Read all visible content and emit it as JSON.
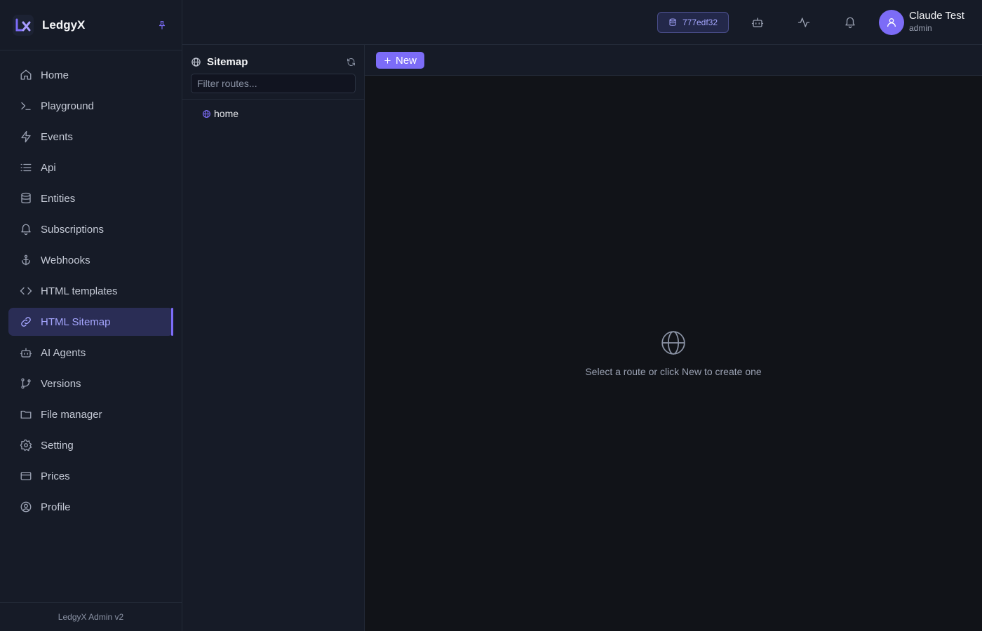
{
  "app": {
    "name": "LedgyX",
    "footer": "LedgyX Admin v2"
  },
  "colors": {
    "accent": "#7c6cf7",
    "active_bg": "#2a2d55",
    "sidebar_bg": "#161b27",
    "main_bg": "#111318"
  },
  "sidebar": {
    "items": [
      {
        "label": "Home",
        "icon": "home-icon"
      },
      {
        "label": "Playground",
        "icon": "terminal-icon"
      },
      {
        "label": "Events",
        "icon": "zap-icon"
      },
      {
        "label": "Api",
        "icon": "list-icon"
      },
      {
        "label": "Entities",
        "icon": "database-icon"
      },
      {
        "label": "Subscriptions",
        "icon": "bell-icon"
      },
      {
        "label": "Webhooks",
        "icon": "anchor-icon"
      },
      {
        "label": "HTML templates",
        "icon": "code-icon"
      },
      {
        "label": "HTML Sitemap",
        "icon": "link-icon",
        "active": true
      },
      {
        "label": "AI Agents",
        "icon": "bot-icon"
      },
      {
        "label": "Versions",
        "icon": "git-branch-icon"
      },
      {
        "label": "File manager",
        "icon": "folder-icon"
      },
      {
        "label": "Setting",
        "icon": "gear-icon"
      },
      {
        "label": "Prices",
        "icon": "credit-card-icon"
      },
      {
        "label": "Profile",
        "icon": "user-circle-icon"
      }
    ]
  },
  "topbar": {
    "db_id": "777edf32",
    "user": {
      "name": "Claude Test",
      "role": "admin"
    }
  },
  "sitemap": {
    "title": "Sitemap",
    "filter_placeholder": "Filter routes...",
    "filter_value": "",
    "routes": [
      "home"
    ]
  },
  "main": {
    "new_label": "New",
    "empty_text": "Select a route or click New to create one"
  }
}
